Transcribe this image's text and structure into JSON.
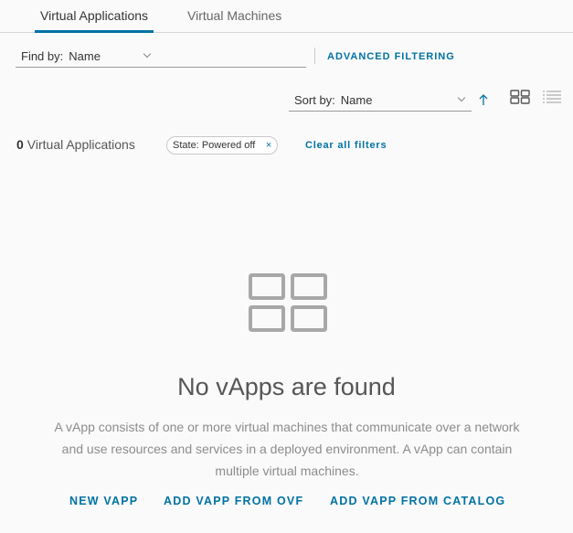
{
  "tabs": [
    {
      "label": "Virtual Applications",
      "active": true
    },
    {
      "label": "Virtual Machines",
      "active": false
    }
  ],
  "filter": {
    "find_by_label": "Find by:",
    "find_by_value": "Name",
    "advanced_label": "ADVANCED FILTERING"
  },
  "sort": {
    "label": "Sort by:",
    "value": "Name",
    "direction": "ascending"
  },
  "view": {
    "selected": "grid"
  },
  "results": {
    "count": "0",
    "label": "Virtual Applications"
  },
  "chips": [
    {
      "key": "State:",
      "value": "Powered off"
    }
  ],
  "clear_label": "Clear all filters",
  "empty": {
    "title": "No vApps are found",
    "description": "A vApp consists of one or more virtual machines that communicate over a network and use resources and services in a deployed environment. A vApp can contain multiple virtual machines."
  },
  "actions": [
    {
      "label": "NEW VAPP"
    },
    {
      "label": "ADD VAPP FROM OVF"
    },
    {
      "label": "ADD VAPP FROM CATALOG"
    }
  ],
  "colors": {
    "accent": "#0072a3",
    "text": "#333333",
    "muted": "#8c8c8c",
    "icon": "#a8a8a8"
  }
}
